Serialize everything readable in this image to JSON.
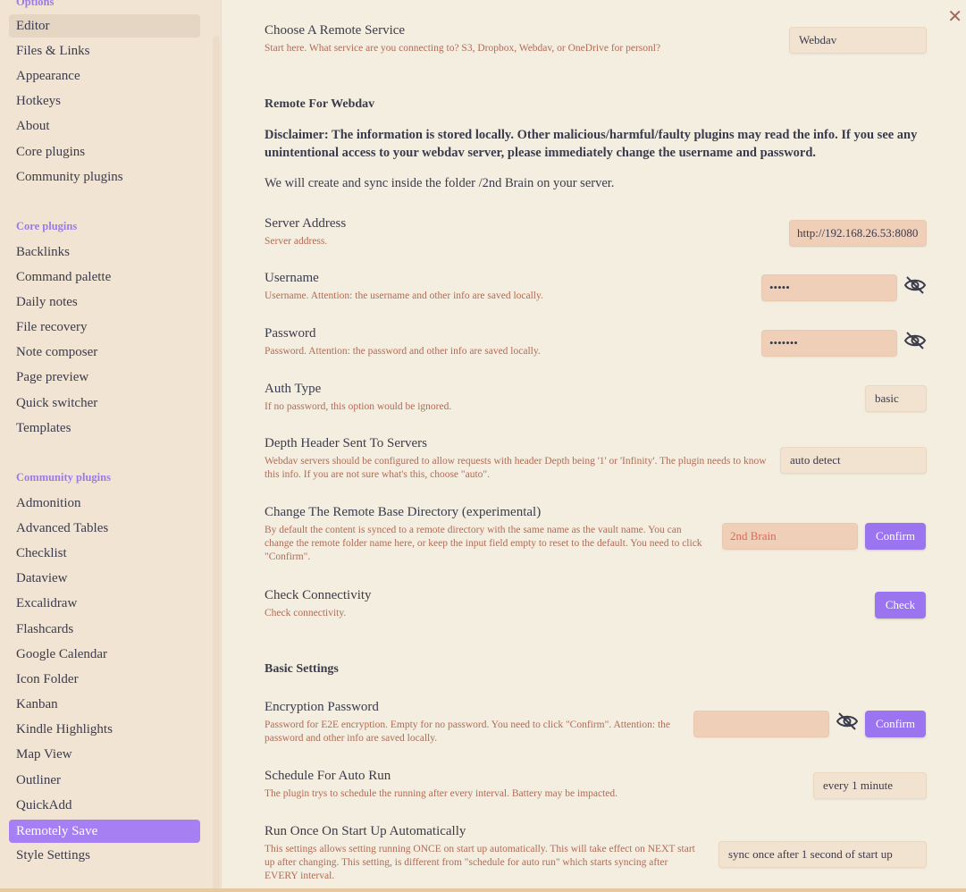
{
  "sidebar": {
    "options_header": "Options",
    "options_items": [
      "Editor",
      "Files & Links",
      "Appearance",
      "Hotkeys",
      "About",
      "Core plugins",
      "Community plugins"
    ],
    "core_header": "Core plugins",
    "core_items": [
      "Backlinks",
      "Command palette",
      "Daily notes",
      "File recovery",
      "Note composer",
      "Page preview",
      "Quick switcher",
      "Templates"
    ],
    "community_header": "Community plugins",
    "community_items": [
      "Admonition",
      "Advanced Tables",
      "Checklist",
      "Dataview",
      "Excalidraw",
      "Flashcards",
      "Google Calendar",
      "Icon Folder",
      "Kanban",
      "Kindle Highlights",
      "Map View",
      "Outliner",
      "QuickAdd",
      "Remotely Save",
      "Style Settings"
    ]
  },
  "main": {
    "remote_service": {
      "name": "Choose A Remote Service",
      "desc": "Start here. What service are you connecting to? S3, Dropbox, Webdav, or OneDrive for personl?",
      "value": "Webdav"
    },
    "webdav_header": "Remote For Webdav",
    "disclaimer": "Disclaimer: The information is stored locally. Other malicious/harmful/faulty plugins may read the info. If you see any unintentional access to your webdav server, please immediately change the username and password.",
    "folder_note": "We will create and sync inside the folder /2nd Brain on your server.",
    "server_address": {
      "name": "Server Address",
      "desc": "Server address.",
      "value": "http://192.168.26.53:8080"
    },
    "username": {
      "name": "Username",
      "desc": "Username. Attention: the username and other info are saved locally.",
      "value": "•••••"
    },
    "password": {
      "name": "Password",
      "desc": "Password. Attention: the password and other info are saved locally.",
      "value": "•••••••"
    },
    "auth_type": {
      "name": "Auth Type",
      "desc": "If no password, this option would be ignored.",
      "value": "basic"
    },
    "depth_header": {
      "name": "Depth Header Sent To Servers",
      "desc": "Webdav servers should be configured to allow requests with header Depth being '1' or 'Infinity'. The plugin needs to know this info. If you are not sure what's this, choose \"auto\".",
      "value": "auto detect"
    },
    "remote_base_dir": {
      "name": "Change The Remote Base Directory (experimental)",
      "desc": "By default the content is synced to a remote directory with the same name as the vault name. You can change the remote folder name here, or keep the input field empty to reset to the default. You need to click \"Confirm\".",
      "placeholder": "2nd Brain",
      "button": "Confirm"
    },
    "check_connectivity": {
      "name": "Check Connectivity",
      "desc": "Check connectivity.",
      "button": "Check"
    },
    "basic_header": "Basic Settings",
    "encryption_password": {
      "name": "Encryption Password",
      "desc": "Password for E2E encryption. Empty for no password. You need to click \"Confirm\". Attention: the password and other info are saved locally.",
      "value": "",
      "button": "Confirm"
    },
    "schedule_auto_run": {
      "name": "Schedule For Auto Run",
      "desc": "The plugin trys to schedule the running after every interval. Battery may be impacted.",
      "value": "every 1 minute"
    },
    "run_once_startup": {
      "name": "Run Once On Start Up Automatically",
      "desc": "This settings allows setting running ONCE on start up automatically. This will take effect on NEXT start up after changing. This setting, is different from \"schedule for auto run\" which starts syncing after EVERY interval.",
      "value": "sync once after 1 second of start up"
    }
  },
  "icons": {
    "close": "close-icon",
    "eye": "eye-off-icon"
  },
  "colors": {
    "accent": "#9b74f0",
    "background": "#f4eee0",
    "sidebar": "#f1e4d3",
    "desc_text": "#b36a55"
  }
}
